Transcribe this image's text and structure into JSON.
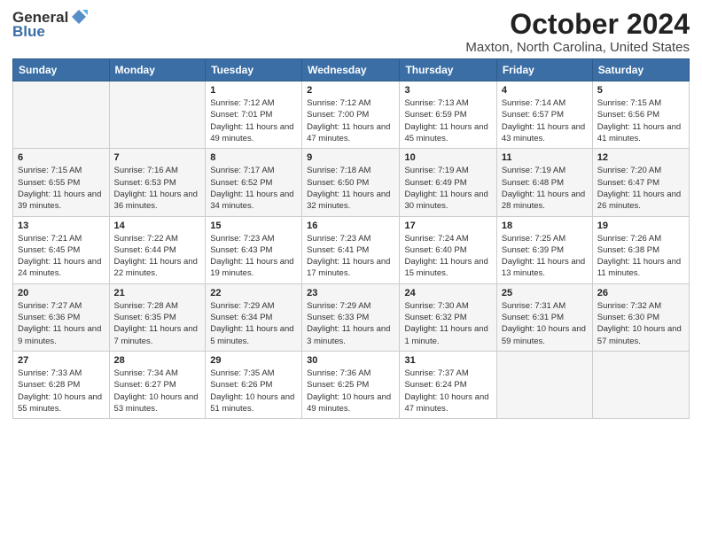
{
  "header": {
    "logo_general": "General",
    "logo_blue": "Blue",
    "title": "October 2024",
    "subtitle": "Maxton, North Carolina, United States"
  },
  "weekdays": [
    "Sunday",
    "Monday",
    "Tuesday",
    "Wednesday",
    "Thursday",
    "Friday",
    "Saturday"
  ],
  "weeks": [
    [
      {
        "day": "",
        "info": ""
      },
      {
        "day": "",
        "info": ""
      },
      {
        "day": "1",
        "info": "Sunrise: 7:12 AM\nSunset: 7:01 PM\nDaylight: 11 hours and 49 minutes."
      },
      {
        "day": "2",
        "info": "Sunrise: 7:12 AM\nSunset: 7:00 PM\nDaylight: 11 hours and 47 minutes."
      },
      {
        "day": "3",
        "info": "Sunrise: 7:13 AM\nSunset: 6:59 PM\nDaylight: 11 hours and 45 minutes."
      },
      {
        "day": "4",
        "info": "Sunrise: 7:14 AM\nSunset: 6:57 PM\nDaylight: 11 hours and 43 minutes."
      },
      {
        "day": "5",
        "info": "Sunrise: 7:15 AM\nSunset: 6:56 PM\nDaylight: 11 hours and 41 minutes."
      }
    ],
    [
      {
        "day": "6",
        "info": "Sunrise: 7:15 AM\nSunset: 6:55 PM\nDaylight: 11 hours and 39 minutes."
      },
      {
        "day": "7",
        "info": "Sunrise: 7:16 AM\nSunset: 6:53 PM\nDaylight: 11 hours and 36 minutes."
      },
      {
        "day": "8",
        "info": "Sunrise: 7:17 AM\nSunset: 6:52 PM\nDaylight: 11 hours and 34 minutes."
      },
      {
        "day": "9",
        "info": "Sunrise: 7:18 AM\nSunset: 6:50 PM\nDaylight: 11 hours and 32 minutes."
      },
      {
        "day": "10",
        "info": "Sunrise: 7:19 AM\nSunset: 6:49 PM\nDaylight: 11 hours and 30 minutes."
      },
      {
        "day": "11",
        "info": "Sunrise: 7:19 AM\nSunset: 6:48 PM\nDaylight: 11 hours and 28 minutes."
      },
      {
        "day": "12",
        "info": "Sunrise: 7:20 AM\nSunset: 6:47 PM\nDaylight: 11 hours and 26 minutes."
      }
    ],
    [
      {
        "day": "13",
        "info": "Sunrise: 7:21 AM\nSunset: 6:45 PM\nDaylight: 11 hours and 24 minutes."
      },
      {
        "day": "14",
        "info": "Sunrise: 7:22 AM\nSunset: 6:44 PM\nDaylight: 11 hours and 22 minutes."
      },
      {
        "day": "15",
        "info": "Sunrise: 7:23 AM\nSunset: 6:43 PM\nDaylight: 11 hours and 19 minutes."
      },
      {
        "day": "16",
        "info": "Sunrise: 7:23 AM\nSunset: 6:41 PM\nDaylight: 11 hours and 17 minutes."
      },
      {
        "day": "17",
        "info": "Sunrise: 7:24 AM\nSunset: 6:40 PM\nDaylight: 11 hours and 15 minutes."
      },
      {
        "day": "18",
        "info": "Sunrise: 7:25 AM\nSunset: 6:39 PM\nDaylight: 11 hours and 13 minutes."
      },
      {
        "day": "19",
        "info": "Sunrise: 7:26 AM\nSunset: 6:38 PM\nDaylight: 11 hours and 11 minutes."
      }
    ],
    [
      {
        "day": "20",
        "info": "Sunrise: 7:27 AM\nSunset: 6:36 PM\nDaylight: 11 hours and 9 minutes."
      },
      {
        "day": "21",
        "info": "Sunrise: 7:28 AM\nSunset: 6:35 PM\nDaylight: 11 hours and 7 minutes."
      },
      {
        "day": "22",
        "info": "Sunrise: 7:29 AM\nSunset: 6:34 PM\nDaylight: 11 hours and 5 minutes."
      },
      {
        "day": "23",
        "info": "Sunrise: 7:29 AM\nSunset: 6:33 PM\nDaylight: 11 hours and 3 minutes."
      },
      {
        "day": "24",
        "info": "Sunrise: 7:30 AM\nSunset: 6:32 PM\nDaylight: 11 hours and 1 minute."
      },
      {
        "day": "25",
        "info": "Sunrise: 7:31 AM\nSunset: 6:31 PM\nDaylight: 10 hours and 59 minutes."
      },
      {
        "day": "26",
        "info": "Sunrise: 7:32 AM\nSunset: 6:30 PM\nDaylight: 10 hours and 57 minutes."
      }
    ],
    [
      {
        "day": "27",
        "info": "Sunrise: 7:33 AM\nSunset: 6:28 PM\nDaylight: 10 hours and 55 minutes."
      },
      {
        "day": "28",
        "info": "Sunrise: 7:34 AM\nSunset: 6:27 PM\nDaylight: 10 hours and 53 minutes."
      },
      {
        "day": "29",
        "info": "Sunrise: 7:35 AM\nSunset: 6:26 PM\nDaylight: 10 hours and 51 minutes."
      },
      {
        "day": "30",
        "info": "Sunrise: 7:36 AM\nSunset: 6:25 PM\nDaylight: 10 hours and 49 minutes."
      },
      {
        "day": "31",
        "info": "Sunrise: 7:37 AM\nSunset: 6:24 PM\nDaylight: 10 hours and 47 minutes."
      },
      {
        "day": "",
        "info": ""
      },
      {
        "day": "",
        "info": ""
      }
    ]
  ]
}
